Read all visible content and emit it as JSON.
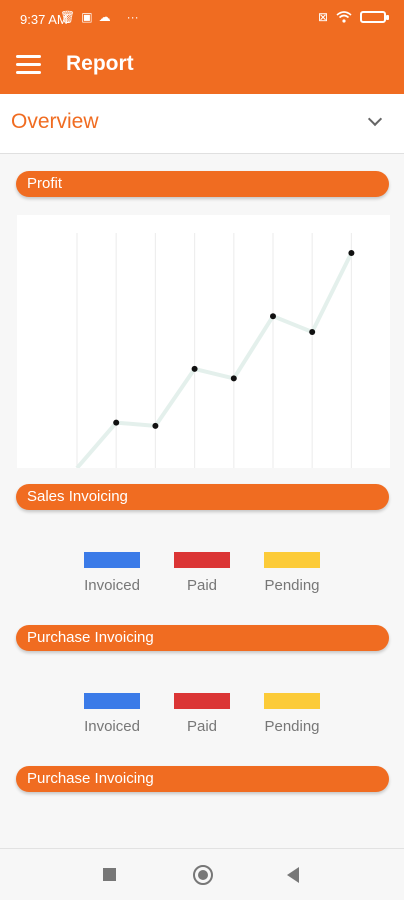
{
  "status_bar": {
    "time": "9:37 AM",
    "left_icons": [
      "trash-icon",
      "gallery-icon",
      "cloud-icon",
      "more-dots-icon"
    ],
    "right_icons": [
      "sim-off-icon",
      "wifi-icon",
      "battery-icon"
    ],
    "battery": "85"
  },
  "app_bar": {
    "title": "Report",
    "menu_icon": "hamburger-icon"
  },
  "overview": {
    "label": "Overview",
    "chevron": "chevron-down-icon"
  },
  "sections": {
    "profit": "Profit",
    "sales": "Sales Invoicing",
    "purchase1": "Purchase Invoicing",
    "purchase2": "Purchase Invoicing"
  },
  "legend_sales": [
    {
      "label": "Invoiced",
      "color": "#3b7be8"
    },
    {
      "label": "Paid",
      "color": "#db3535"
    },
    {
      "label": "Pending",
      "color": "#fccb38"
    }
  ],
  "legend_purchase": [
    {
      "label": "Invoiced",
      "color": "#3b7be8"
    },
    {
      "label": "Paid",
      "color": "#db3535"
    },
    {
      "label": "Pending",
      "color": "#fccb38"
    }
  ],
  "colors": {
    "accent": "#f06c21",
    "line": "#e4f0ec",
    "grid": "#eeeeee",
    "point": "#111111"
  },
  "chart_data": {
    "type": "line",
    "title": "",
    "xlabel": "",
    "ylabel": "",
    "grid": true,
    "x": [
      0,
      1,
      2,
      3,
      4,
      5,
      6,
      7
    ],
    "series": [
      {
        "values": [
          0,
          4.3,
          4.0,
          9.4,
          8.5,
          14.4,
          12.9,
          20.4
        ]
      }
    ],
    "ylim": [
      0,
      24
    ]
  },
  "nav": {
    "icons": [
      "recents-square-icon",
      "home-circle-icon",
      "back-triangle-icon"
    ]
  }
}
